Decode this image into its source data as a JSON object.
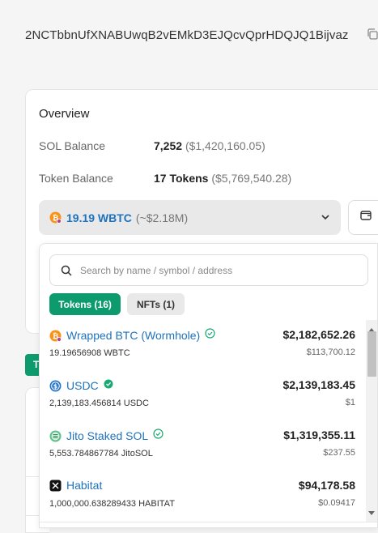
{
  "address": "2NCTbbnUfXNABUwqB2vEMkD3EJQcvQprHDQJQ1Bijvaz",
  "overview": {
    "title": "Overview",
    "sol_balance_label": "SOL Balance",
    "sol_balance_value": "7,252",
    "sol_balance_usd": "($1,420,160.05)",
    "token_balance_label": "Token Balance",
    "token_balance_value": "17 Tokens",
    "token_balance_usd": "($5,769,540.28)"
  },
  "selector": {
    "amount": "19.19 WBTC",
    "approx": "(~$2.18M)"
  },
  "background_tab_letter": "T",
  "dropdown": {
    "search_placeholder": "Search by name / symbol / address",
    "tabs": [
      {
        "label": "Tokens (16)",
        "active": true
      },
      {
        "label": "NFTs (1)",
        "active": false
      }
    ],
    "items": [
      {
        "name": "Wrapped BTC (Wormhole)",
        "qty": "19.19656908 WBTC",
        "usd": "$2,182,652.26",
        "price": "$113,700.12",
        "icon": "wbtc-icon",
        "verified": "outline"
      },
      {
        "name": "USDC",
        "qty": "2,139,183.456814 USDC",
        "usd": "$2,139,183.45",
        "price": "$1",
        "icon": "usdc-icon",
        "verified": "filled"
      },
      {
        "name": "Jito Staked SOL",
        "qty": "5,553.784867784 JitoSOL",
        "usd": "$1,319,355.11",
        "price": "$237.55",
        "icon": "jitosol-icon",
        "verified": "outline"
      },
      {
        "name": "Habitat",
        "qty": "1,000,000.638289433 HABITAT",
        "usd": "$94,178.58",
        "price": "$0.09417",
        "icon": "habitat-icon",
        "verified": "none"
      }
    ]
  },
  "colors": {
    "accent_green": "#0d9b6e",
    "link_blue": "#1e73be",
    "btc_orange": "#f7931a",
    "usdc_blue": "#2775ca"
  }
}
